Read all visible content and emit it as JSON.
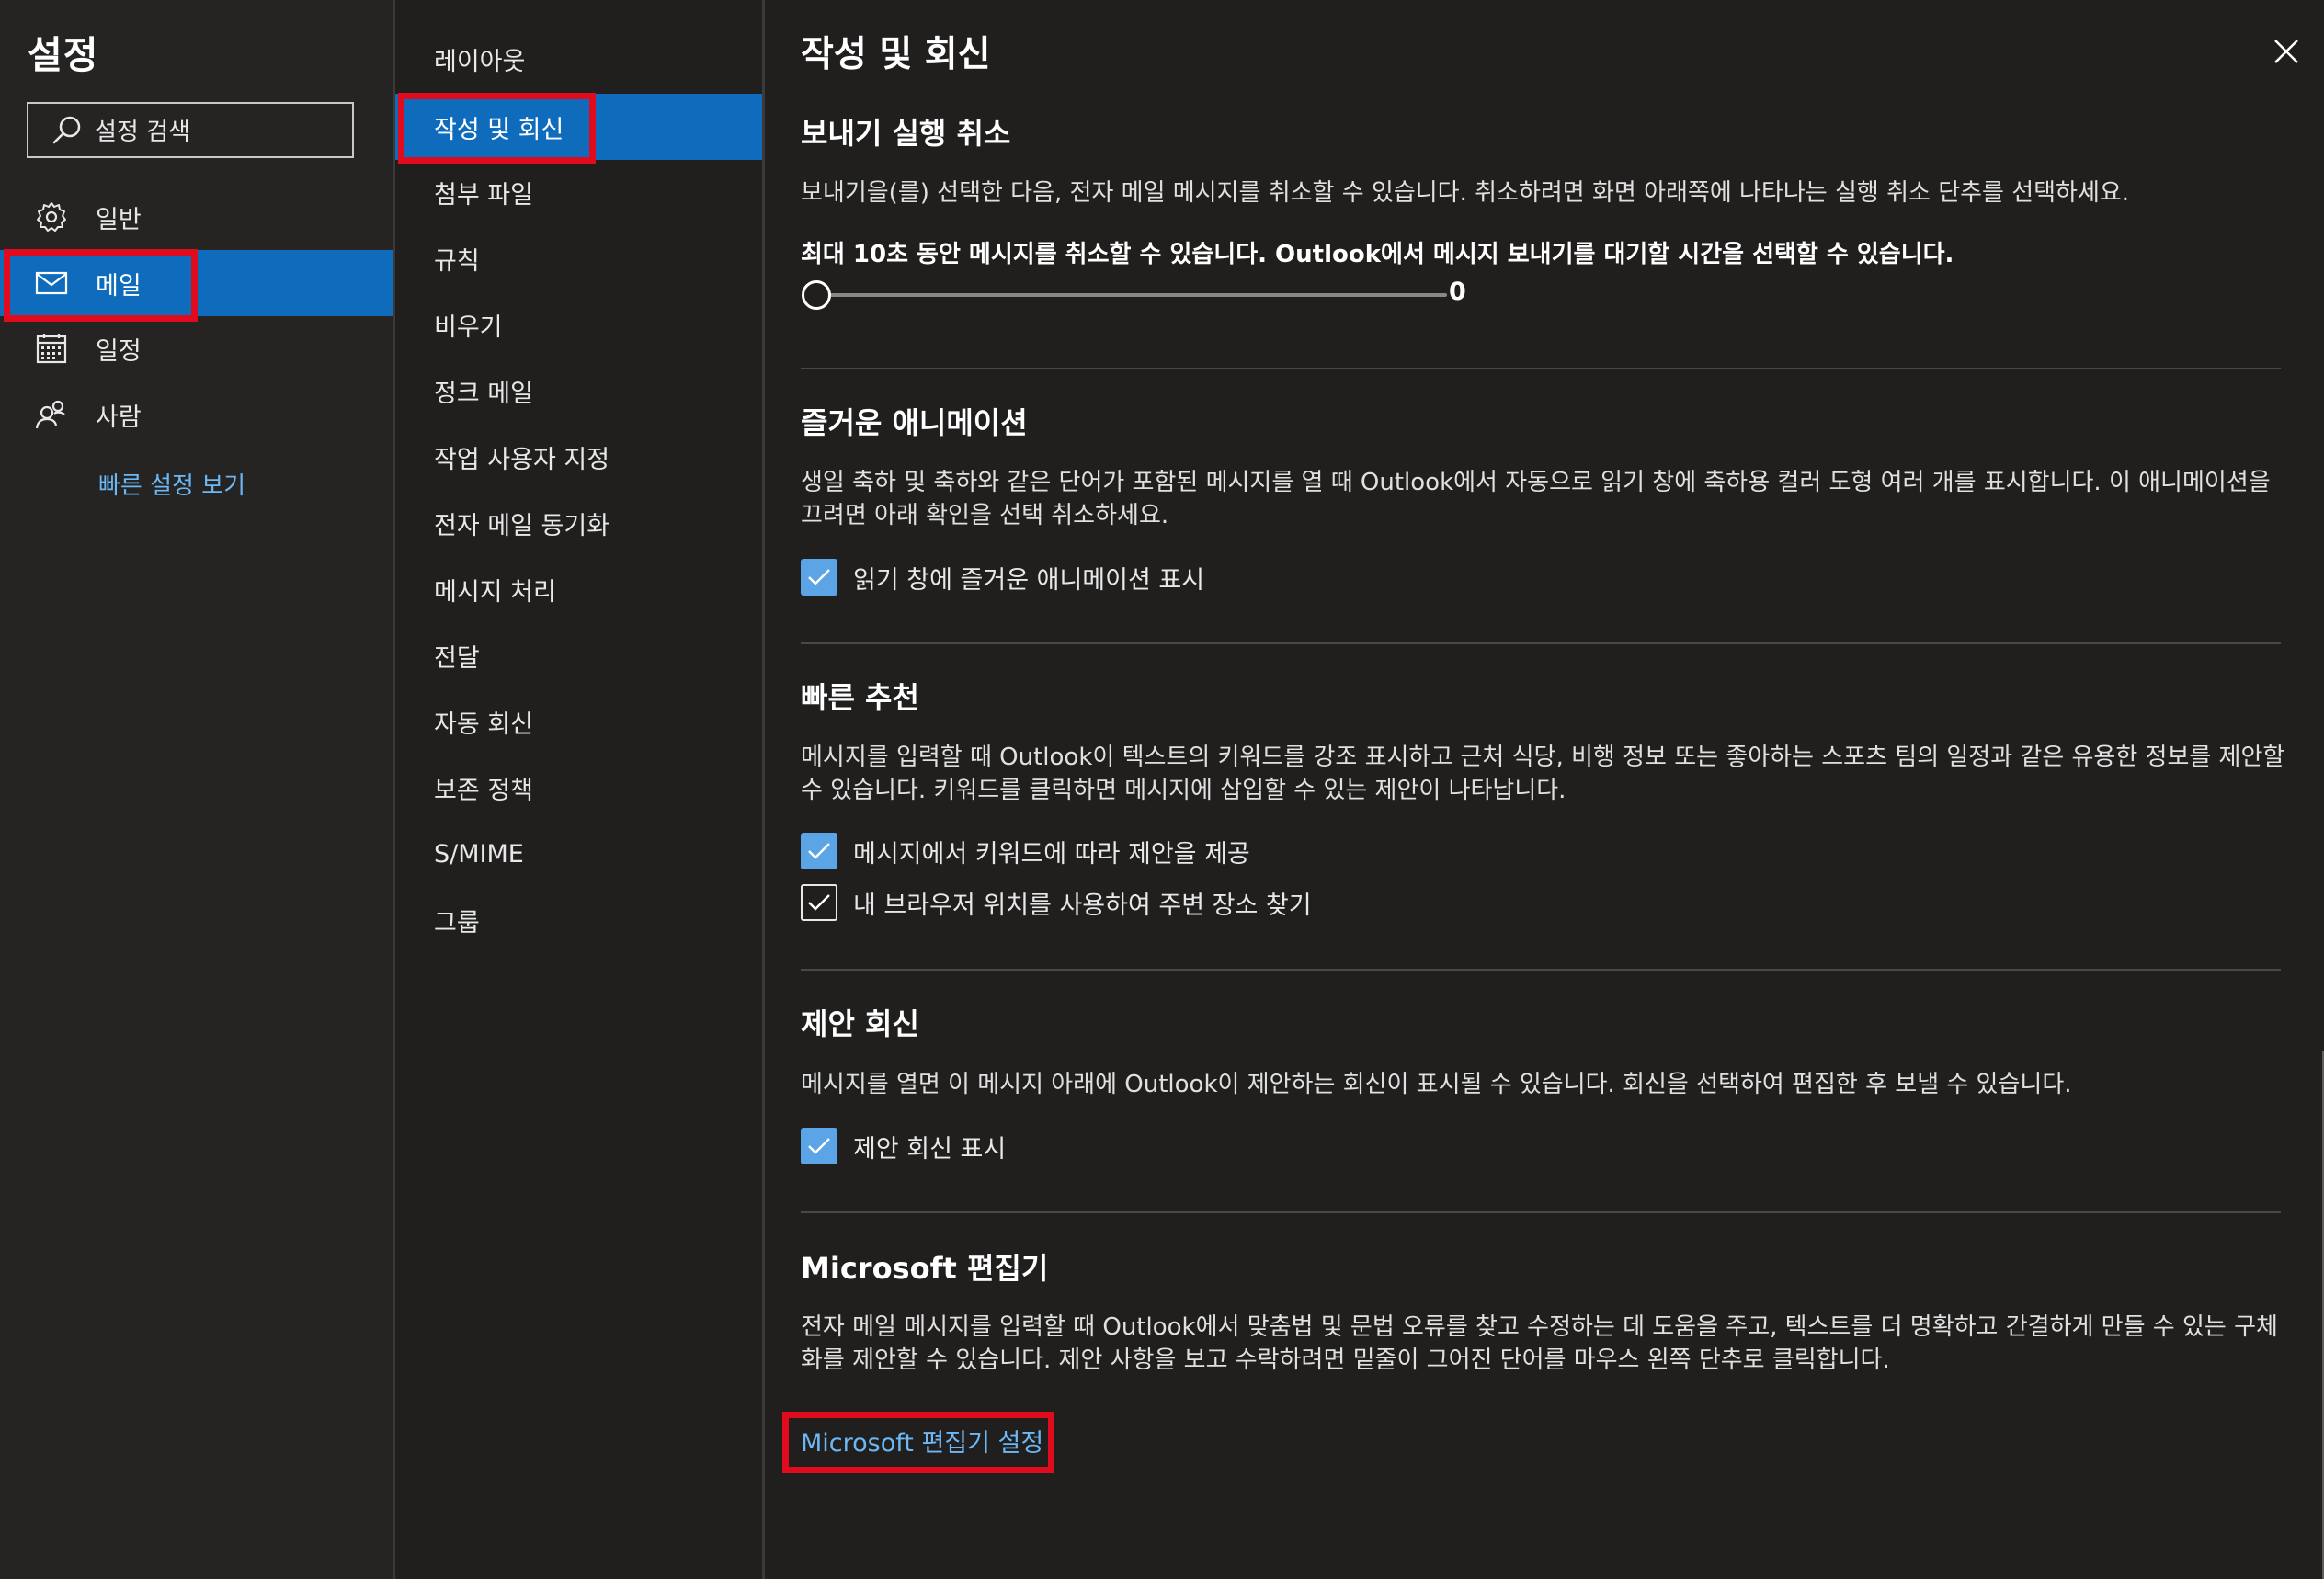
{
  "colors": {
    "accent": "#0f6cbd",
    "checkbox_checked": "#5ba4e5",
    "link": "#6cb8f6",
    "highlight_box": "#e00b1c"
  },
  "sidebar": {
    "title": "설정",
    "search": {
      "placeholder": "설정 검색",
      "icon": "search-icon"
    },
    "categories": [
      {
        "label": "일반",
        "icon": "gear-icon"
      },
      {
        "label": "메일",
        "icon": "mail-icon",
        "selected": true
      },
      {
        "label": "일정",
        "icon": "calendar-icon"
      },
      {
        "label": "사람",
        "icon": "people-icon"
      }
    ],
    "quick_settings_link": "빠른 설정 보기"
  },
  "subnav": {
    "items": [
      {
        "label": "레이아웃"
      },
      {
        "label": "작성 및 회신",
        "selected": true
      },
      {
        "label": "첨부 파일"
      },
      {
        "label": "규칙"
      },
      {
        "label": "비우기"
      },
      {
        "label": "정크 메일"
      },
      {
        "label": "작업 사용자 지정"
      },
      {
        "label": "전자 메일 동기화"
      },
      {
        "label": "메시지 처리"
      },
      {
        "label": "전달"
      },
      {
        "label": "자동 회신"
      },
      {
        "label": "보존 정책"
      },
      {
        "label": "S/MIME"
      },
      {
        "label": "그룹"
      }
    ]
  },
  "content": {
    "title": "작성 및 회신",
    "close_icon": "close-icon",
    "undo_send": {
      "title": "보내기 실행 취소",
      "description": "보내기을(를) 선택한 다음, 전자 메일 메시지를 취소할 수 있습니다. 취소하려면 화면 아래쪽에 나타나는 실행 취소 단추를 선택하세요.",
      "slider_label": "최대 10초 동안 메시지를 취소할 수 있습니다. Outlook에서 메시지 보내기를 대기할 시간을 선택할 수 있습니다.",
      "slider_value": "0",
      "slider_fraction": 0
    },
    "animations": {
      "title": "즐거운 애니메이션",
      "description": "생일 축하 및 축하와 같은 단어가 포함된 메시지를 열 때 Outlook에서 자동으로 읽기 창에 축하용 컬러 도형 여러 개를 표시합니다. 이 애니메이션을 끄려면 아래 확인을 선택 취소하세요.",
      "checkbox_label": "읽기 창에 즐거운 애니메이션 표시",
      "checked": true
    },
    "suggestions": {
      "title": "빠른 추천",
      "description": "메시지를 입력할 때 Outlook이 텍스트의 키워드를 강조 표시하고 근처 식당, 비행 정보 또는 좋아하는 스포츠 팀의 일정과 같은 유용한 정보를 제안할 수 있습니다. 키워드를 클릭하면 메시지에 삽입할 수 있는 제안이 나타납니다.",
      "checkbox1_label": "메시지에서 키워드에 따라 제안을 제공",
      "checkbox1_checked": true,
      "checkbox2_label": "내 브라우저 위치를 사용하여 주변 장소 찾기",
      "checkbox2_checked": true
    },
    "suggested_replies": {
      "title": "제안 회신",
      "description": "메시지를 열면 이 메시지 아래에 Outlook이 제안하는 회신이 표시될 수 있습니다. 회신을 선택하여 편집한 후 보낼 수 있습니다.",
      "checkbox_label": "제안 회신 표시",
      "checked": true
    },
    "editor": {
      "title": "Microsoft 편집기",
      "description": "전자 메일 메시지를 입력할 때 Outlook에서 맞춤법 및 문법 오류를 찾고 수정하는 데 도움을 주고, 텍스트를 더 명확하고 간결하게 만들 수 있는 구체화를 제안할 수 있습니다. 제안 사항을 보고 수락하려면 밑줄이 그어진 단어를 마우스 왼쪽 단추로 클릭합니다.",
      "link": "Microsoft 편집기 설정"
    }
  }
}
